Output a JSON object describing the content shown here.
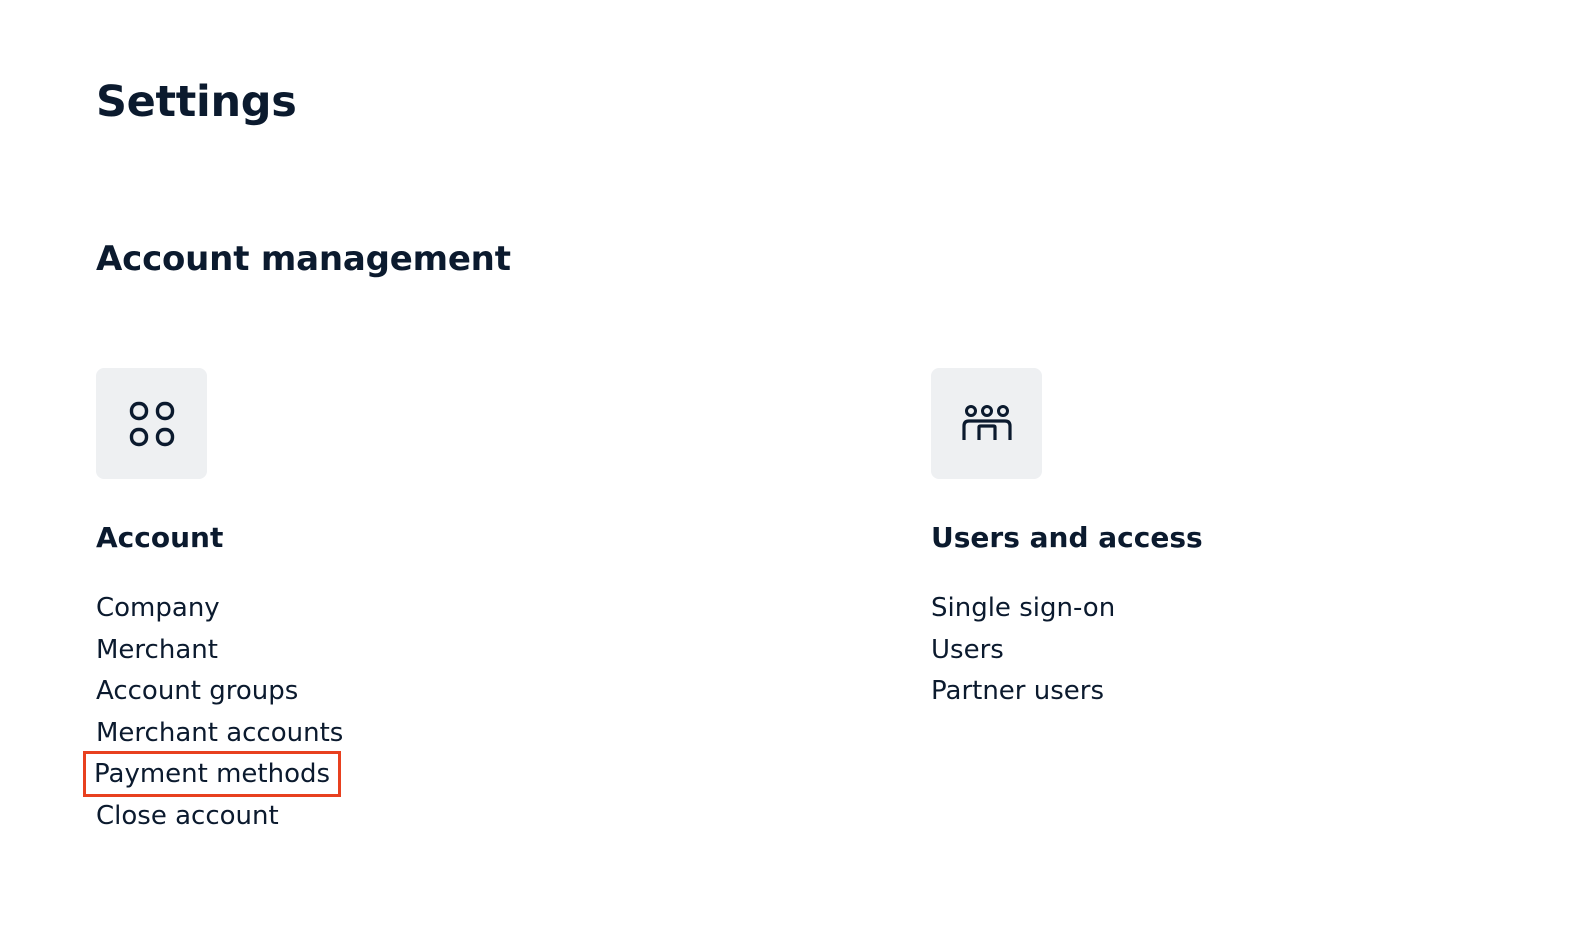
{
  "page_title": "Settings",
  "section_title": "Account management",
  "cards": [
    {
      "title": "Account",
      "icon": "apps-grid-icon",
      "links": [
        "Company",
        "Merchant",
        "Account groups",
        "Merchant accounts",
        "Payment methods",
        "Close account"
      ]
    },
    {
      "title": "Users and access",
      "icon": "users-group-icon",
      "links": [
        "Single sign-on",
        "Users",
        "Partner users"
      ]
    }
  ],
  "colors": {
    "text": "#0b1a2e",
    "icon_tile_bg": "#eef0f2",
    "highlight_outline": "#e8401f"
  }
}
